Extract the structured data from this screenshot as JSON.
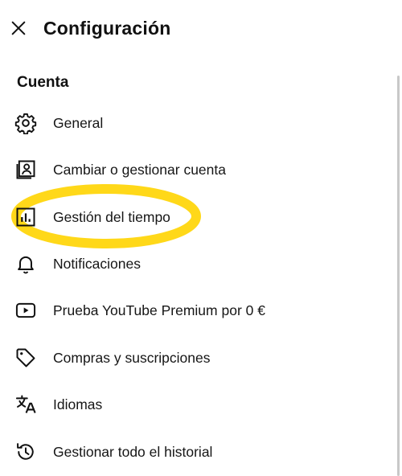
{
  "header": {
    "title": "Configuración",
    "close_icon": "close-icon"
  },
  "section": {
    "title": "Cuenta"
  },
  "items": [
    {
      "label": "General",
      "icon": "gear-icon"
    },
    {
      "label": "Cambiar o gestionar cuenta",
      "icon": "account-box-icon"
    },
    {
      "label": "Gestión del tiempo",
      "icon": "bar-chart-icon",
      "highlighted": true
    },
    {
      "label": "Notificaciones",
      "icon": "bell-icon"
    },
    {
      "label": "Prueba YouTube Premium por 0 €",
      "icon": "play-box-icon"
    },
    {
      "label": "Compras y suscripciones",
      "icon": "tag-icon"
    },
    {
      "label": "Idiomas",
      "icon": "translate-icon"
    },
    {
      "label": "Gestionar todo el historial",
      "icon": "history-icon"
    }
  ],
  "colors": {
    "highlight": "#ffd400",
    "text": "#161616"
  }
}
